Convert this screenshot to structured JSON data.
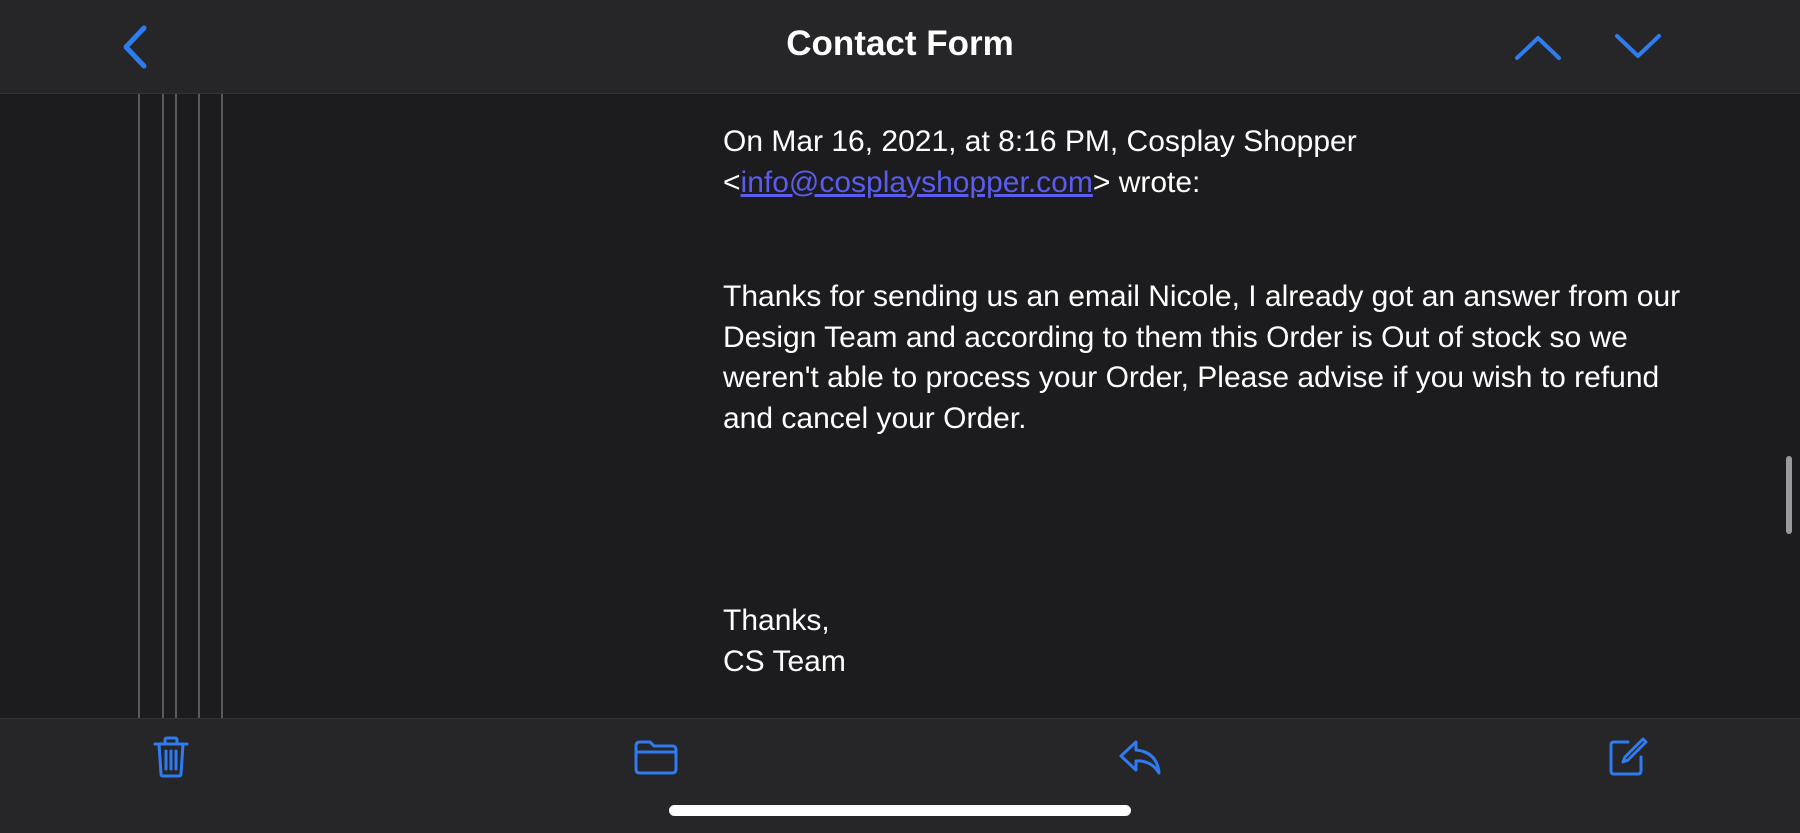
{
  "nav": {
    "title": "Contact Form",
    "back_icon": "chevron-left-icon",
    "prev_icon": "chevron-up-icon",
    "next_icon": "chevron-down-icon"
  },
  "message": {
    "header_prefix": "On Mar 16, 2021, at 8:16 PM, Cosplay Shopper",
    "header_open": "<",
    "email": "info@cosplayshopper.com",
    "header_suffix": "> wrote:",
    "body": "Thanks for sending us an email Nicole, I already got an answer from our Design Team and according to them this Order is Out of stock so we weren't able to process your Order, Please advise if you wish to refund and cancel your Order.",
    "signoff": "Thanks,",
    "signature": "CS Team"
  },
  "toolbar": {
    "trash_icon": "trash-icon",
    "folder_icon": "folder-icon",
    "reply_icon": "reply-icon",
    "compose_icon": "compose-icon"
  },
  "colors": {
    "accent": "#2f7bf0",
    "link": "#5a5cf0",
    "background": "#1c1c1e",
    "bar": "#262628"
  }
}
